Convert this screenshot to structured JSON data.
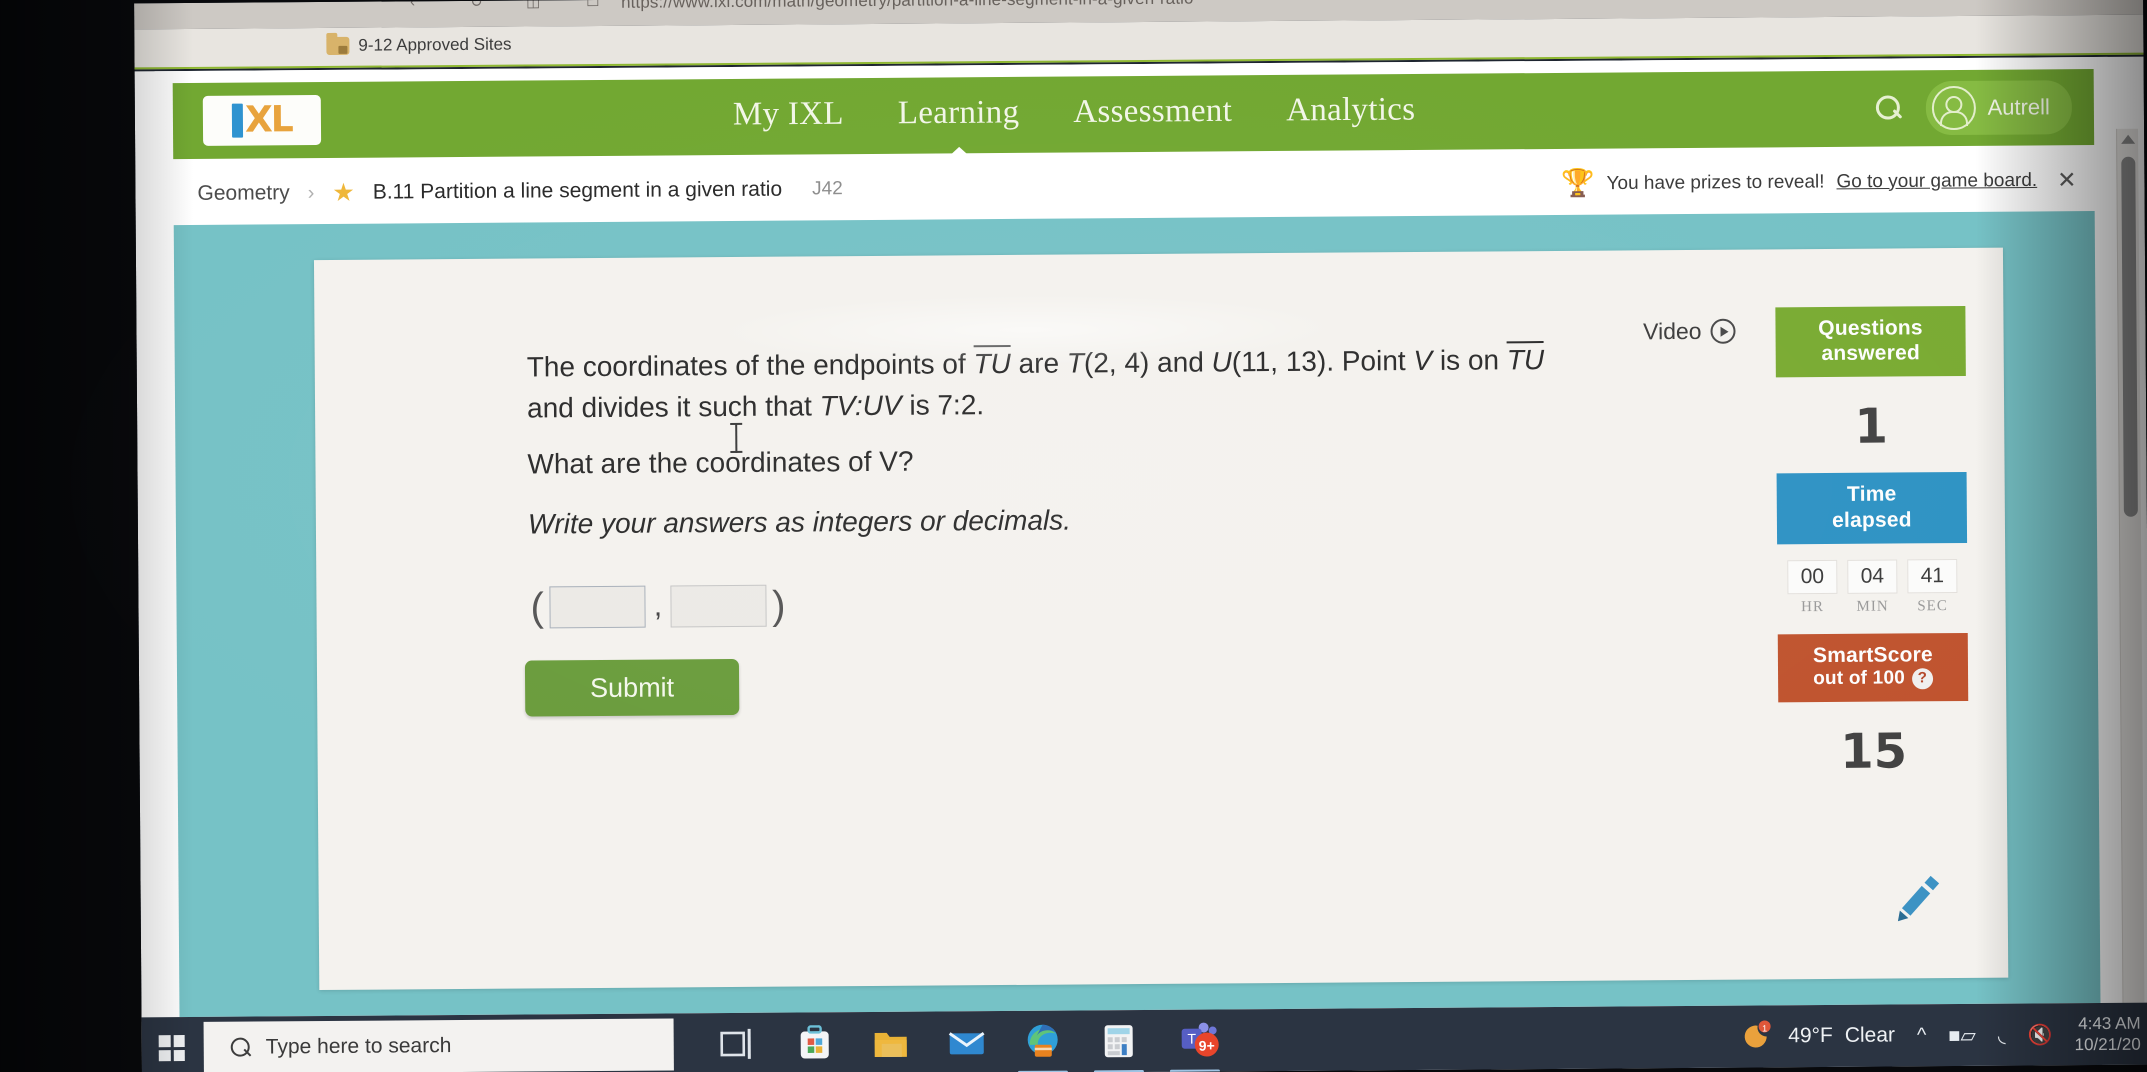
{
  "browser": {
    "url": "https://www.ixl.com/math/geometry/partition-a-line-segment-in-a-given-ratio",
    "bookmark_folder": "9-12 Approved Sites"
  },
  "nav": {
    "logo_i": "I",
    "logo_xl": "XL",
    "links": [
      {
        "label": "My IXL",
        "active": false
      },
      {
        "label": "Learning",
        "active": true
      },
      {
        "label": "Assessment",
        "active": false
      },
      {
        "label": "Analytics",
        "active": false
      }
    ],
    "search_icon": "search-icon",
    "user_name": "Autrell",
    "avatar_icon": "user-avatar-icon"
  },
  "breadcrumb": {
    "subject": "Geometry",
    "separator": "›",
    "star_icon": "★",
    "skill": "B.11 Partition a line segment in a given ratio",
    "skill_code": "J42"
  },
  "prizes": {
    "trophy_icon": "🏆",
    "text": "You have prizes to reveal!",
    "link": "Go to your game board.",
    "close_icon": "✕"
  },
  "question": {
    "line1_a": "The coordinates of the endpoints of ",
    "seg1": "TU",
    "line1_b": " are ",
    "pointT": "T",
    "coordsT": "(2, 4)",
    "line1_c": " and ",
    "pointU": "U",
    "coordsU": "(11, 13)",
    "line1_d": ". Point ",
    "pointV": "V",
    "line1_e": " is on ",
    "seg2": "TU",
    "line1_f": " and divides it such that ",
    "ratio_label": "TV:UV",
    "line1_g": " is ",
    "ratio": "7:2",
    "line1_h": ".",
    "ask_a": "What are the coordinates of ",
    "ask_v": "V",
    "ask_b": "?",
    "note": "Write your answers as integers or decimals.",
    "answer": {
      "open_paren": "(",
      "comma": ",",
      "close_paren": ")",
      "x_value": "",
      "y_value": "",
      "x_placeholder": "",
      "y_placeholder": ""
    },
    "submit_label": "Submit"
  },
  "video": {
    "label": "Video",
    "play_icon": "play-circle-icon"
  },
  "rail": {
    "questions": {
      "head_line1": "Questions",
      "head_line2": "answered",
      "value": "1"
    },
    "time": {
      "head_line1": "Time",
      "head_line2": "elapsed",
      "cells": [
        {
          "value": "00",
          "label": "HR"
        },
        {
          "value": "04",
          "label": "MIN"
        },
        {
          "value": "41",
          "label": "SEC"
        }
      ]
    },
    "smartscore": {
      "head_line1": "SmartScore",
      "head_line2": "out of 100",
      "help_icon": "?",
      "value": "15"
    },
    "pencil_icon": "pencil-icon"
  },
  "taskbar": {
    "start_icon": "windows-start-icon",
    "search_placeholder": "Type here to search",
    "apps": [
      {
        "name": "task-view-icon",
        "running": false
      },
      {
        "name": "microsoft-store-icon",
        "running": false
      },
      {
        "name": "file-explorer-icon",
        "running": false
      },
      {
        "name": "mail-icon",
        "running": false
      },
      {
        "name": "microsoft-edge-icon",
        "running": true
      },
      {
        "name": "calculator-icon",
        "running": true
      },
      {
        "name": "microsoft-teams-icon",
        "running": true,
        "badge": "9+"
      }
    ],
    "weather_temp": "49°F",
    "weather_cond": "Clear",
    "tray_icons": [
      "chevron-up-icon",
      "battery-icon",
      "wifi-icon",
      "volume-muted-icon"
    ],
    "time": "4:43 AM",
    "date": "10/21/20"
  },
  "colors": {
    "ixl_green": "#72a832",
    "teal_band": "#76c2c6",
    "blue_header": "#2f93c4",
    "red_header": "#c0542f",
    "green_header": "#7aab33"
  }
}
